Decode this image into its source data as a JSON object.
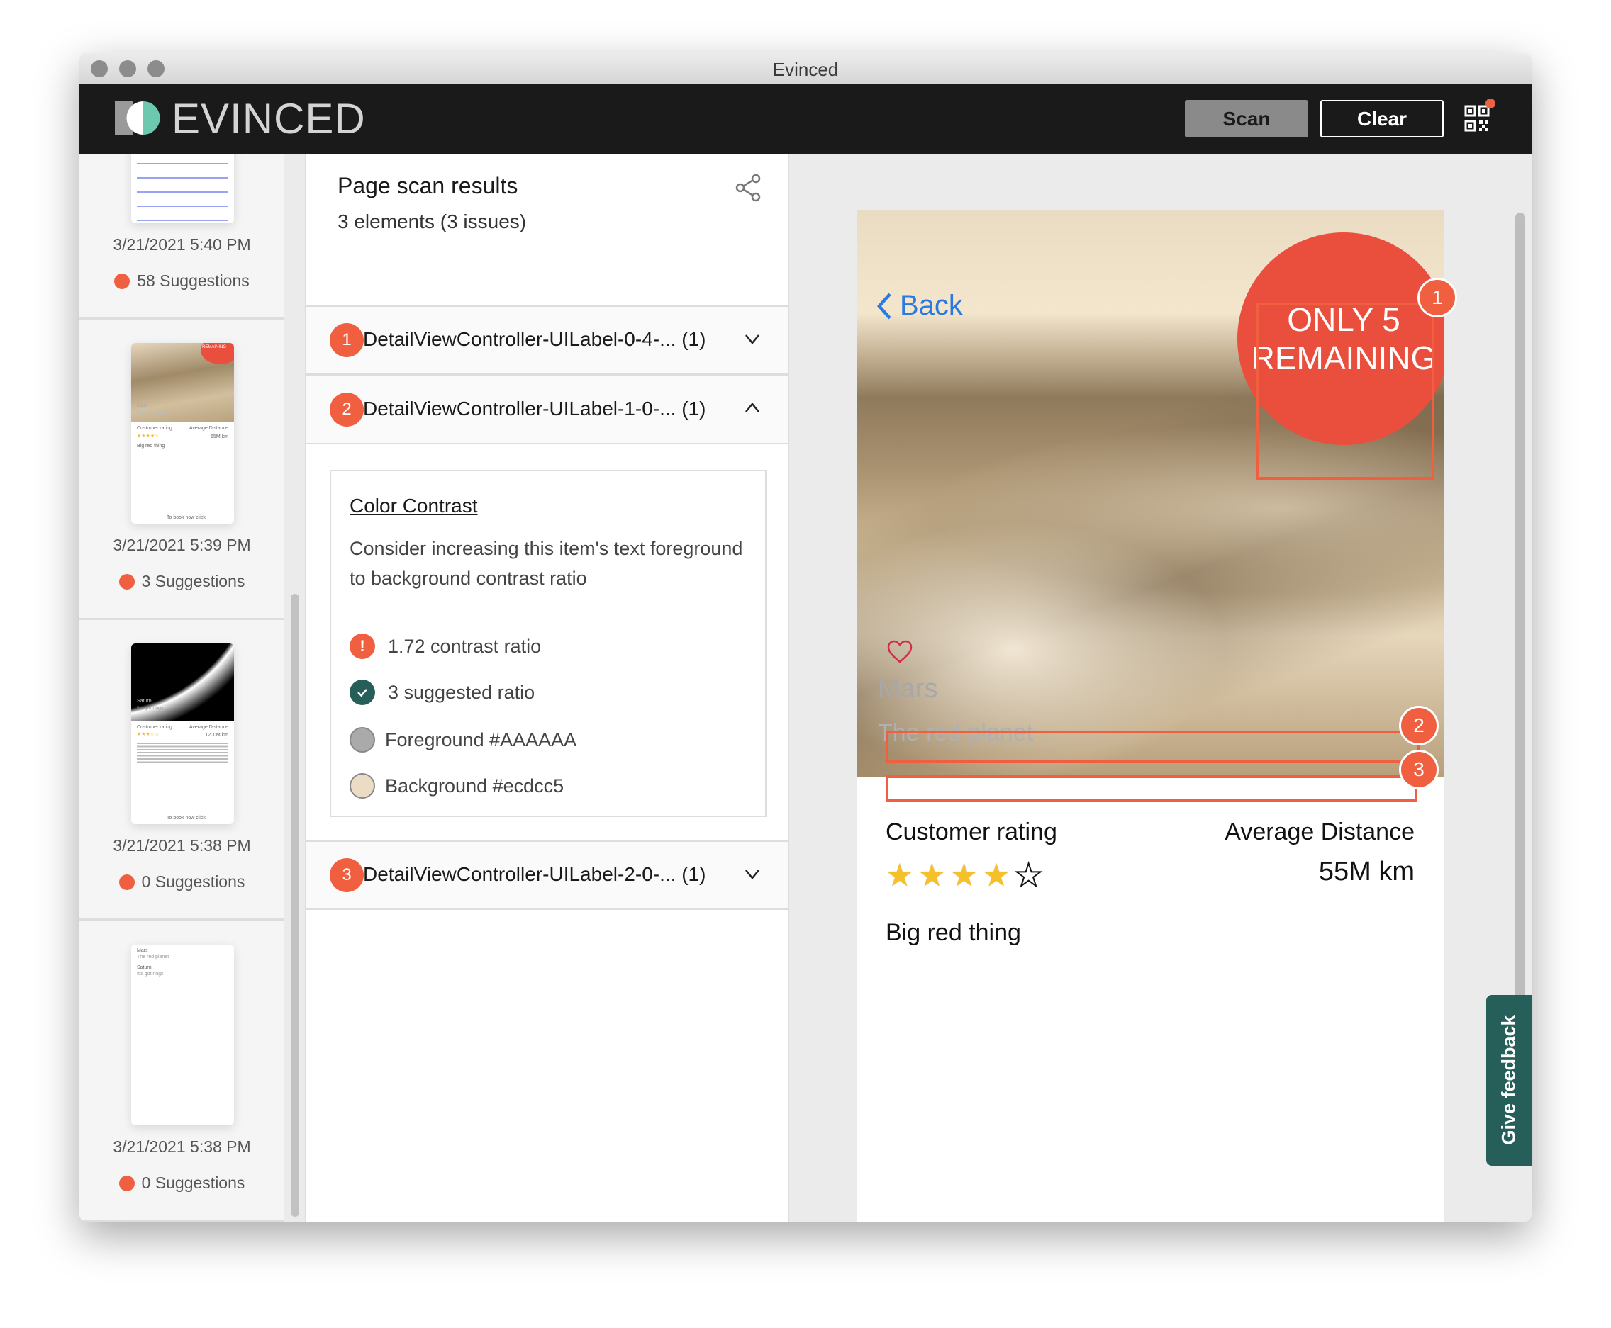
{
  "window": {
    "title": "Evinced"
  },
  "header": {
    "logo_text": "EVINCED",
    "scan_label": "Scan",
    "clear_label": "Clear",
    "qr_icon": "qr-code-icon",
    "notification_color": "#f05f40"
  },
  "sidebar": {
    "items": [
      {
        "date": "3/21/2021 5:40 PM",
        "suggestions": "58 Suggestions",
        "thumb": "form"
      },
      {
        "date": "3/21/2021 5:39 PM",
        "suggestions": "3 Suggestions",
        "thumb": "mars",
        "thumb_texts": [
          "REMAINING",
          "Mars",
          "The red planet",
          "Customer rating",
          "Average Distance",
          "55M km",
          "Big red thing",
          "To book now click"
        ]
      },
      {
        "date": "3/21/2021 5:38 PM",
        "suggestions": "0 Suggestions",
        "thumb": "saturn",
        "thumb_texts": [
          "Saturn",
          "It's got rings",
          "Customer rating",
          "Average Distance",
          "1200M km",
          "To book now click"
        ]
      },
      {
        "date": "3/21/2021 5:38 PM",
        "suggestions": "0 Suggestions",
        "thumb": "list",
        "thumb_texts": [
          "Mars",
          "The red planet",
          "Saturn",
          "It's got rings"
        ]
      }
    ]
  },
  "results": {
    "title": "Page scan results",
    "subtitle": "3 elements (3 issues)",
    "items": [
      {
        "num": "1",
        "label": "DetailViewController-UILabel-0-4-...",
        "count": "(1)",
        "expanded": false
      },
      {
        "num": "2",
        "label": "DetailViewController-UILabel-1-0-...",
        "count": "(1)",
        "expanded": true
      },
      {
        "num": "3",
        "label": "DetailViewController-UILabel-2-0-...",
        "count": "(1)",
        "expanded": false
      }
    ],
    "detail": {
      "title": "Color Contrast",
      "description": "Consider increasing this item's text foreground to background contrast ratio",
      "contrast": "1.72 contrast ratio",
      "suggested": "3 suggested ratio",
      "foreground": "Foreground #AAAAAA",
      "background": "Background #ecdcc5",
      "foreground_color": "#AAAAAA",
      "background_color": "#ecdcc5"
    }
  },
  "preview": {
    "back": "Back",
    "promo_line1": "ONLY 5",
    "promo_line2": "REMAINING",
    "name": "Mars",
    "tagline": "The red planet",
    "rating_label": "Customer rating",
    "rating": 4,
    "rating_max": 5,
    "distance_label": "Average Distance",
    "distance": "55M km",
    "description": "Big red thing",
    "badges": [
      "1",
      "2",
      "3"
    ],
    "highlight_color": "#f05f40"
  },
  "feedback": {
    "label": "Give feedback",
    "color": "#265f59"
  }
}
